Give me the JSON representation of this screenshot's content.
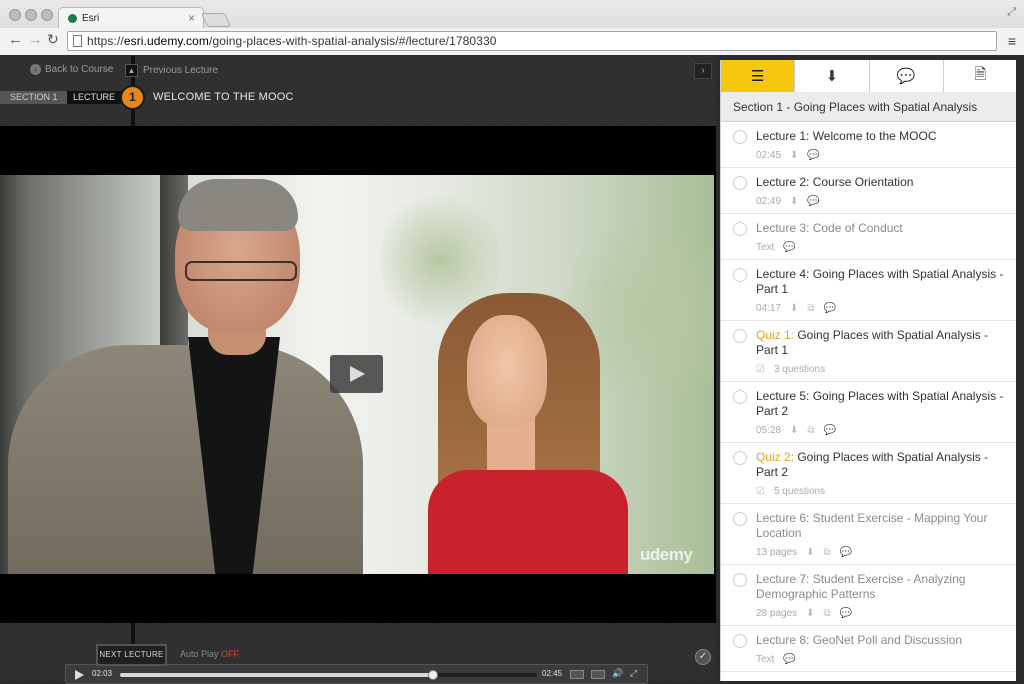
{
  "browser": {
    "tab_title": "Esri",
    "tab_close": "×",
    "url_prefix": "https://",
    "url_host": "esri.udemy.com",
    "url_path": "/going-places-with-spatial-analysis/#/lecture/1780330"
  },
  "player": {
    "back_label": "Back to Course",
    "prev_label": "Previous Lecture",
    "section_label": "SECTION 1",
    "lecture_label": "LECTURE",
    "lecture_number": "1",
    "lecture_heading": "WELCOME TO THE MOOC",
    "watermark": "udemy",
    "current_time": "02:03",
    "duration": "02:45",
    "progress": 0.75,
    "next_label": "NEXT LECTURE",
    "autoplay_label": "Auto Play",
    "autoplay_state": "OFF"
  },
  "sidebar": {
    "section_title": "Section 1 - Going Places with Spatial Analysis",
    "tabs": [
      {
        "icon": "list-icon",
        "active": true
      },
      {
        "icon": "download-icon",
        "active": false
      },
      {
        "icon": "discussion-icon",
        "active": false
      },
      {
        "icon": "notes-icon",
        "active": false
      }
    ],
    "lectures": [
      {
        "prefix": "",
        "title": "Lecture 1: Welcome to the MOOC",
        "meta": "02:45",
        "dim": false
      },
      {
        "prefix": "",
        "title": "Lecture 2: Course Orientation",
        "meta": "02:49",
        "dim": false
      },
      {
        "prefix": "",
        "title": "Lecture 3: Code of Conduct",
        "meta": "Text",
        "dim": true
      },
      {
        "prefix": "",
        "title": "Lecture 4: Going Places with Spatial Analysis - Part 1",
        "meta": "04:17",
        "dim": false
      },
      {
        "prefix": "Quiz 1:",
        "title": " Going Places with Spatial Analysis - Part 1",
        "meta": "3 questions",
        "dim": false
      },
      {
        "prefix": "",
        "title": "Lecture 5: Going Places with Spatial Analysis - Part 2",
        "meta": "05:28",
        "dim": false
      },
      {
        "prefix": "Quiz 2:",
        "title": " Going Places with Spatial Analysis - Part 2",
        "meta": "5 questions",
        "dim": false
      },
      {
        "prefix": "",
        "title": "Lecture 6: Student Exercise - Mapping Your Location",
        "meta": "13 pages",
        "dim": true
      },
      {
        "prefix": "",
        "title": "Lecture 7: Student Exercise - Analyzing Demographic Patterns",
        "meta": "28 pages",
        "dim": true
      },
      {
        "prefix": "",
        "title": "Lecture 8: GeoNet Poll and Discussion",
        "meta": "Text",
        "dim": true
      }
    ]
  }
}
